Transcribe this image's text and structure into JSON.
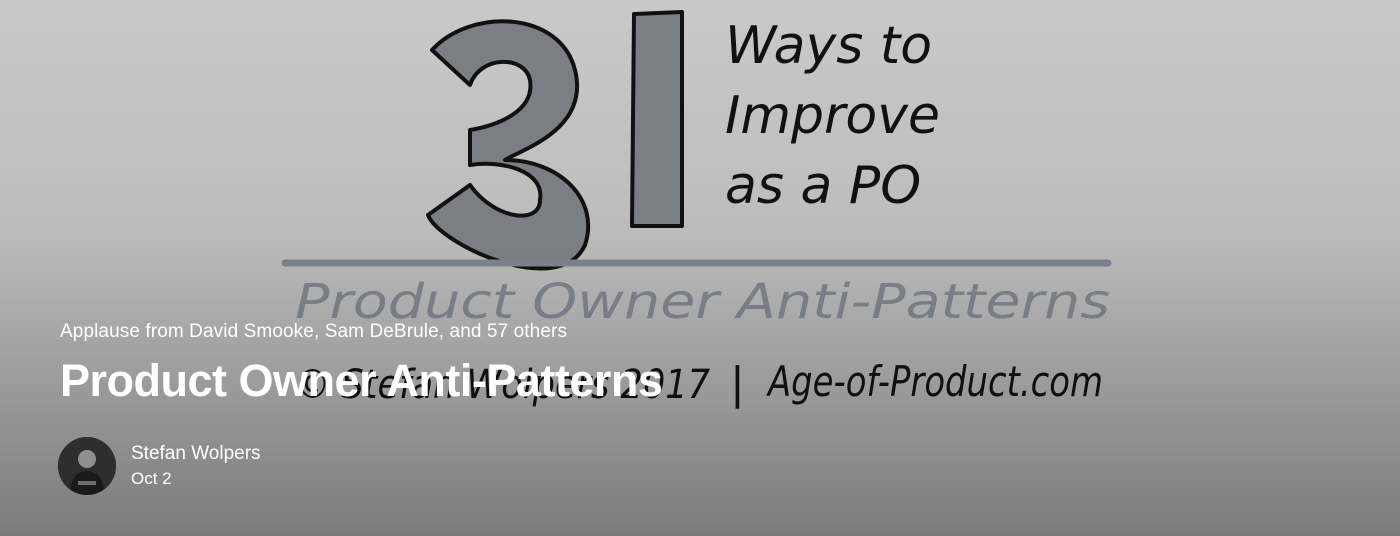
{
  "artwork": {
    "big_number_digit_1": "3",
    "big_number_digit_2": "1",
    "side_line_1": "Ways to",
    "side_line_2": "Improve",
    "side_line_3": "as a PO",
    "underline_text": "Product Owner Anti-Patterns",
    "footer_left": "© Stefan Wolpers 2017",
    "footer_sep": "|",
    "footer_right": "Age-of-Product.com"
  },
  "post": {
    "applause": "Applause from David Smooke, Sam DeBrule, and 57 others",
    "title": "Product Owner Anti-Patterns",
    "author": "Stefan Wolpers",
    "date": "Oct 2"
  },
  "colors": {
    "background": "#bdbdbd",
    "ink": "#111111",
    "fill_gray": "#7b7e85",
    "faint_text": "#7d828c",
    "overlay_text": "#ffffff"
  },
  "icons": {
    "avatar": "author-avatar-photo"
  }
}
